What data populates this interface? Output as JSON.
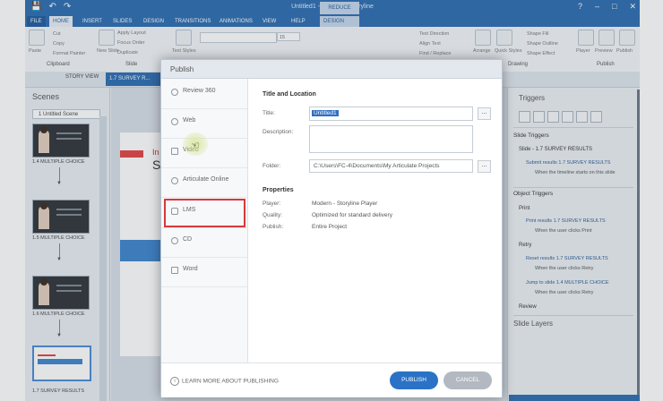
{
  "app": {
    "window_title": "Untitled1 - Articulate Storyline",
    "contextual_tab_group": "REDUCE TOOLS"
  },
  "ribbon": {
    "tabs": [
      "FILE",
      "HOME",
      "INSERT",
      "SLIDES",
      "DESIGN",
      "TRANSITIONS",
      "ANIMATIONS",
      "VIEW",
      "HELP",
      "DESIGN"
    ],
    "active_tab": "HOME",
    "clipboard": {
      "paste": "Paste",
      "cut": "Cut",
      "copy": "Copy",
      "format_painter": "Format Painter",
      "group": "Clipboard"
    },
    "slide": {
      "new_slide": "New Slide",
      "apply_layout": "Apply Layout",
      "focus_order": "Focus Order",
      "duplicate": "Duplicate",
      "group": "Slide"
    },
    "font": {
      "text_styles": "Text Styles",
      "size": "15"
    },
    "paragraph": {
      "text_direction": "Text Direction",
      "align_text": "Align Text",
      "find_replace": "Find / Replace"
    },
    "drawing": {
      "arrange": "Arrange",
      "quick_styles": "Quick Styles",
      "shape_fill": "Shape Fill",
      "shape_outline": "Shape Outline",
      "shape_effect": "Shape Effect",
      "group": "Drawing"
    },
    "publish": {
      "player": "Player",
      "preview": "Preview",
      "publish": "Publish",
      "group": "Publish"
    }
  },
  "view_tabs": {
    "story_view": "STORY VIEW",
    "slide_tab": "1.7 SURVEY R..."
  },
  "scenes": {
    "title": "Scenes",
    "selector": "1 Untitled Scene",
    "items": [
      {
        "label": "1.4 MULTIPLE CHOICE"
      },
      {
        "label": "1.5 MULTIPLE CHOICE"
      },
      {
        "label": "1.6 MULTIPLE CHOICE"
      },
      {
        "label": "1.7 SURVEY RESULTS"
      }
    ]
  },
  "stage": {
    "slide_text_1": "In",
    "slide_text_2": "S"
  },
  "triggers": {
    "title": "Triggers",
    "slide_triggers": "Slide Triggers",
    "slide_name": "Slide - 1.7 SURVEY RESULTS",
    "slide_trigger_action": "Submit results 1.7 SURVEY RESULTS",
    "slide_trigger_when": "When the timeline starts on this slide",
    "object_triggers": "Object Triggers",
    "groups": [
      {
        "name": "Print",
        "actions": [
          {
            "action": "Print results 1.7 SURVEY RESULTS",
            "when": "When the user clicks Print"
          }
        ]
      },
      {
        "name": "Retry",
        "actions": [
          {
            "action": "Reset results 1.7 SURVEY RESULTS",
            "when": "When the user clicks Retry"
          },
          {
            "action": "Jump to slide 1.4 MULTIPLE CHOICE",
            "when": "When the user clicks Retry"
          }
        ]
      },
      {
        "name": "Review",
        "actions": []
      }
    ],
    "slide_layers": "Slide Layers"
  },
  "dialog": {
    "title": "Publish",
    "nav": [
      {
        "label": "Review 360",
        "icon": "review-icon"
      },
      {
        "label": "Web",
        "icon": "globe-icon"
      },
      {
        "label": "Video",
        "icon": "video-icon"
      },
      {
        "label": "Articulate Online",
        "icon": "cloud-icon"
      },
      {
        "label": "LMS",
        "icon": "database-icon"
      },
      {
        "label": "CD",
        "icon": "cd-icon"
      },
      {
        "label": "Word",
        "icon": "document-icon"
      }
    ],
    "highlighted_item": "LMS",
    "title_location_heading": "Title and Location",
    "title_label": "Title:",
    "title_value": "Untitled1",
    "description_label": "Description:",
    "description_value": "",
    "folder_label": "Folder:",
    "folder_value": "C:\\Users\\FC-4\\Documents\\My Articulate Projects",
    "browse_label": "...",
    "properties_heading": "Properties",
    "player_label": "Player:",
    "player_value": "Modern - Storyline Player",
    "quality_label": "Quality:",
    "quality_value": "Optimized for standard delivery",
    "publish_label": "Publish:",
    "publish_value": "Entire Project",
    "learn_more": "LEARN MORE ABOUT PUBLISHING",
    "publish_button": "PUBLISH",
    "cancel_button": "CANCEL"
  },
  "colors": {
    "accent": "#2b6cb2",
    "highlight_box": "#d63a3a",
    "publish_button": "#2a72c6"
  }
}
